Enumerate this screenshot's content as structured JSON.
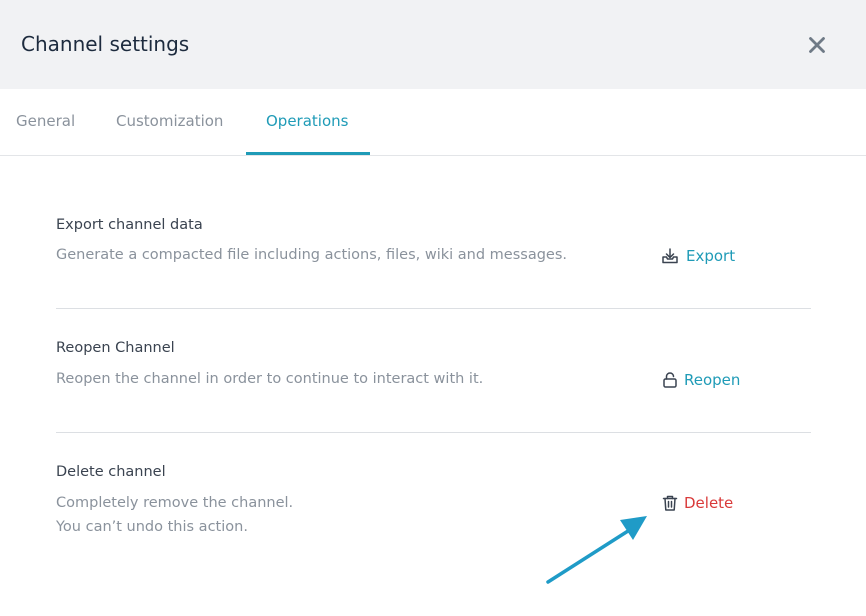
{
  "header": {
    "title": "Channel settings",
    "close_icon": "close-icon"
  },
  "tabs": [
    {
      "label": "General",
      "active": false
    },
    {
      "label": "Customization",
      "active": false
    },
    {
      "label": "Operations",
      "active": true
    }
  ],
  "sections": {
    "export": {
      "title": "Export channel data",
      "description": "Generate a compacted file including actions, files, wiki and messages.",
      "action_label": "Export",
      "icon": "download-tray-icon"
    },
    "reopen": {
      "title": "Reopen Channel",
      "description": "Reopen the channel in order to continue to interact with it.",
      "action_label": "Reopen",
      "icon": "unlock-icon"
    },
    "delete": {
      "title": "Delete channel",
      "description_line1": "Completely remove the channel.",
      "description_line2": "You can’t undo this action.",
      "action_label": "Delete",
      "icon": "trash-icon"
    }
  },
  "colors": {
    "accent": "#1f9bb7",
    "danger": "#d93a3a",
    "header_bg": "#f1f2f4",
    "arrow": "#1f9bc7"
  }
}
